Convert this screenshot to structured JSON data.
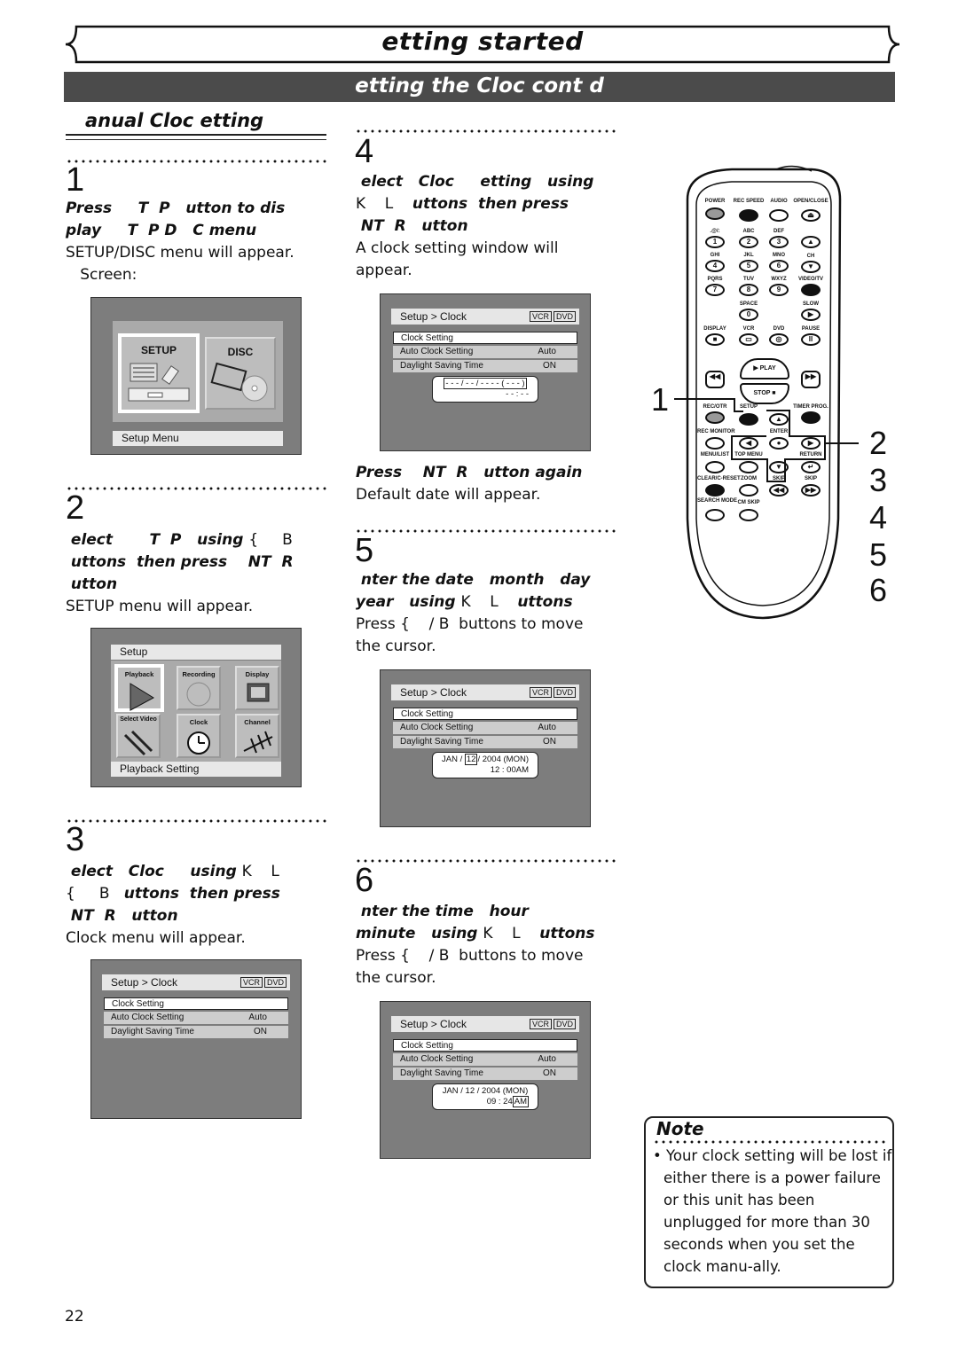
{
  "header": {
    "title": "etting started",
    "subtitle": "etting the Cloc    cont d"
  },
  "section_heading": "anual Cloc    etting",
  "steps": [
    {
      "num": "1",
      "lines": [
        [
          {
            "t": "Press     T  P   utton to dis",
            "b": true
          }
        ],
        [
          {
            "t": "play     T  P D   C menu",
            "b": true
          }
        ],
        [
          {
            "t": "SETUP/DISC menu will appear.",
            "b": false
          }
        ],
        [
          {
            "t": "   Screen:",
            "b": false
          }
        ]
      ]
    },
    {
      "num": "2",
      "lines": [
        [
          {
            "t": " elect       T  P   using ",
            "b": true
          },
          {
            "t": "{     B",
            "b": false
          }
        ],
        [
          {
            "t": " uttons  then press    NT  R",
            "b": true
          }
        ],
        [
          {
            "t": " utton",
            "b": true
          }
        ],
        [
          {
            "t": "SETUP menu will appear.",
            "b": false
          }
        ]
      ]
    },
    {
      "num": "3",
      "lines": [
        [
          {
            "t": " elect   Cloc     using ",
            "b": true
          },
          {
            "t": "K    L",
            "b": false
          }
        ],
        [
          {
            "t": "{     B   ",
            "b": false
          },
          {
            "t": "uttons  then press",
            "b": true
          }
        ],
        [
          {
            "t": " NT  R   utton",
            "b": true
          }
        ],
        [
          {
            "t": "Clock menu will appear.",
            "b": false
          }
        ]
      ]
    },
    {
      "num": "4",
      "lines": [
        [
          {
            "t": " elect   Cloc     etting   using",
            "b": true
          }
        ],
        [
          {
            "t": "K    L    ",
            "b": false
          },
          {
            "t": "uttons  then press",
            "b": true
          }
        ],
        [
          {
            "t": " NT  R   utton",
            "b": true
          }
        ],
        [
          {
            "t": "A clock setting window will",
            "b": false
          }
        ],
        [
          {
            "t": "appear.",
            "b": false
          }
        ]
      ],
      "after_lines": [
        [
          {
            "t": "Press    NT  R   utton again",
            "b": true
          }
        ],
        [
          {
            "t": "Default date will appear.",
            "b": false
          }
        ]
      ]
    },
    {
      "num": "5",
      "lines": [
        [
          {
            "t": " nter the date   month   day",
            "b": true
          }
        ],
        [
          {
            "t": "year   using ",
            "b": true
          },
          {
            "t": "K    L    ",
            "b": false
          },
          {
            "t": "uttons",
            "b": true
          }
        ],
        [
          {
            "t": "Press {    / B  buttons to move",
            "b": false
          }
        ],
        [
          {
            "t": "the cursor.",
            "b": false
          }
        ]
      ]
    },
    {
      "num": "6",
      "lines": [
        [
          {
            "t": " nter the time   hour",
            "b": true
          }
        ],
        [
          {
            "t": "minute   using ",
            "b": true
          },
          {
            "t": "K    L    ",
            "b": false
          },
          {
            "t": "uttons",
            "b": true
          }
        ],
        [
          {
            "t": "Press {    / B  buttons to move",
            "b": false
          }
        ],
        [
          {
            "t": "the cursor.",
            "b": false
          }
        ]
      ]
    }
  ],
  "screens": {
    "setup_disc": {
      "tiles": [
        "SETUP",
        "DISC"
      ],
      "footer": "Setup Menu"
    },
    "setup": {
      "header": "Setup",
      "tiles": [
        "Playback",
        "Recording",
        "Display",
        "Select Video",
        "Clock",
        "Channel"
      ],
      "footer": "Playback Setting"
    },
    "clock": {
      "header": "Setup > Clock",
      "badges": [
        "VCR",
        "DVD"
      ],
      "rows": [
        {
          "label": "Clock Setting",
          "value": ""
        },
        {
          "label": "Auto Clock Setting",
          "value": "Auto"
        },
        {
          "label": "Daylight Saving Time",
          "value": "ON"
        }
      ],
      "popup_blank": {
        "date": "- - - / - - / - - - - ( - - - )",
        "time": "- - : - -"
      },
      "popup_date": {
        "month": "JAN /",
        "day": "12",
        "rest": "/ 2004 (MON)",
        "time": "12 : 00AM"
      },
      "popup_time": {
        "date": "JAN / 12 / 2004 (MON)",
        "time": "09 : 24",
        "ampm": "AM"
      }
    }
  },
  "remote": {
    "top_labels": [
      "POWER",
      "REC SPEED",
      "AUDIO",
      "OPEN/CLOSE"
    ],
    "num_labels": [
      ".@/:",
      "ABC",
      "DEF",
      "GHI",
      "JKL",
      "MNO",
      "PQRS",
      "TUV",
      "WXYZ",
      "VIDEO/TV"
    ],
    "numbers": [
      "1",
      "2",
      "3",
      "4",
      "5",
      "6",
      "7",
      "8",
      "9",
      "0"
    ],
    "ch_label": "CH",
    "space": "SPACE",
    "slow": "SLOW",
    "row_labels": [
      "DISPLAY",
      "VCR",
      "DVD",
      "PAUSE"
    ],
    "play": "PLAY",
    "stop": "STOP",
    "lower_labels": [
      "REC/OTR",
      "SETUP",
      "TIMER PROG.",
      "REC MONITOR",
      "ENTER",
      "MENU/LIST",
      "TOP MENU",
      "RETURN",
      "CLEAR/C-RESET",
      "ZOOM",
      "SKIP",
      "SKIP",
      "SEARCH MODE",
      "CM SKIP"
    ],
    "callouts": [
      "1",
      "2",
      "3",
      "4",
      "5",
      "6"
    ]
  },
  "note": {
    "title": "Note",
    "text": "• Your clock setting will be lost if either there is a power failure or this unit has been unplugged for more than 30 seconds when you set the clock manu-ally."
  },
  "page_number": "22"
}
